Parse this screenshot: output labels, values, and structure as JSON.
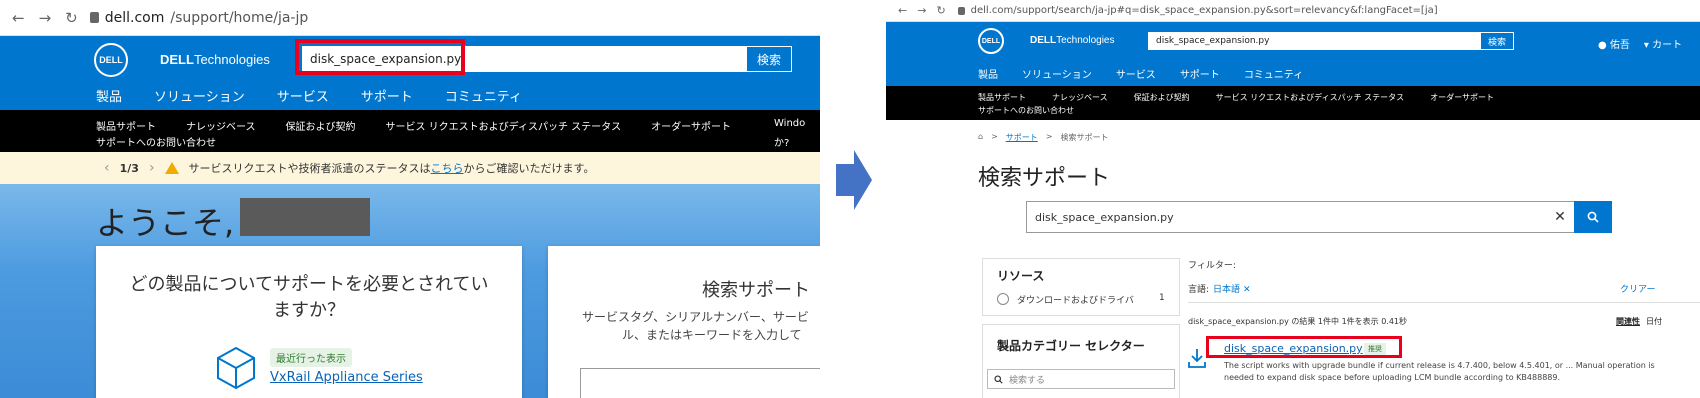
{
  "left": {
    "browser": {
      "url_host": "dell.com",
      "url_path": "/support/home/ja-jp",
      "back": "←",
      "forward": "→",
      "reload": "↻"
    },
    "header": {
      "logo": "DELL",
      "brand_bold": "DELL",
      "brand_rest": "Technologies",
      "search_value": "disk_space_expansion.py",
      "search_button": "検索"
    },
    "nav": [
      "製品",
      "ソリューション",
      "サービス",
      "サポート",
      "コミュニティ"
    ],
    "subnav": [
      "製品サポート",
      "ナレッジベース",
      "保証および契約",
      "サービス リクエストおよびディスパッチ ステータス",
      "オーダーサポート"
    ],
    "subnav_line2": "サポートへのお問い合わせ",
    "windows_text": "Windo",
    "windows_text2": "か?",
    "notice": {
      "pager": "1/3",
      "prev": "‹",
      "next": "›",
      "text_before": "サービスリクエストや技術者派遣のステータスは",
      "link": "こちら",
      "text_after": "からご確認いただけます。"
    },
    "welcome": "ようこそ,",
    "card1": {
      "title_line1": "どの製品についてサポートを必要とされてい",
      "title_line2": "ますか？",
      "badge": "最近行った表示",
      "recent_link": "VxRail Appliance Series"
    },
    "card2": {
      "title": "検索サポート",
      "desc_line1": "サービスタグ、シリアルナンバー、サービ",
      "desc_line2": "ル、またはキーワードを入力して"
    }
  },
  "right": {
    "browser": {
      "url": "dell.com/support/search/ja-jp#q=disk_space_expansion.py&sort=relevancy&f:langFacet=[ja]",
      "back": "←",
      "forward": "→",
      "reload": "↻"
    },
    "header": {
      "logo": "DELL",
      "brand_bold": "DELL",
      "brand_rest": "Technologies",
      "search_value": "disk_space_expansion.py",
      "search_button": "検索",
      "user": "佑吾",
      "cart": "カート"
    },
    "nav": [
      "製品",
      "ソリューション",
      "サービス",
      "サポート",
      "コミュニティ"
    ],
    "subnav": [
      "製品サポート",
      "ナレッジベース",
      "保証および契約",
      "サービス リクエストおよびディスパッチ ステータス",
      "オーダーサポート"
    ],
    "subnav_line2": "サポートへのお問い合わせ",
    "breadcrumb": {
      "home": "⌂",
      "sep": ">",
      "support": "サポート",
      "current": "検索サポート"
    },
    "page_title": "検索サポート",
    "search_value": "disk_space_expansion.py",
    "sidebar": {
      "resources_title": "リソース",
      "resource_option": "ダウンロードおよびドライバ",
      "resource_count": "1",
      "category_title": "製品カテゴリー セレクター",
      "category_search_placeholder": "検索する"
    },
    "filters": {
      "label": "フィルター:",
      "lang_label": "言語:",
      "lang_value": "日本語",
      "lang_remove": "✕",
      "clear": "クリアー"
    },
    "results_summary": "disk_space_expansion.py の結果 1件中 1件を表示 0.41秒",
    "sort": {
      "relevance": "関連性",
      "date": "日付"
    },
    "result": {
      "title": "disk_space_expansion.py",
      "badge": "推奨",
      "snippet_line1": "The script works with upgrade bundle if current release is 4.7.400, below 4.5.401, or ... Manual operation is",
      "snippet_line2": "needed to expand disk space before uploading LCM bundle according to KB488889."
    }
  },
  "colors": {
    "dell_blue": "#0076ce",
    "highlight_red": "#e8001c",
    "arrow_blue": "#4472c4",
    "notice_bg": "#fdf6dd"
  }
}
